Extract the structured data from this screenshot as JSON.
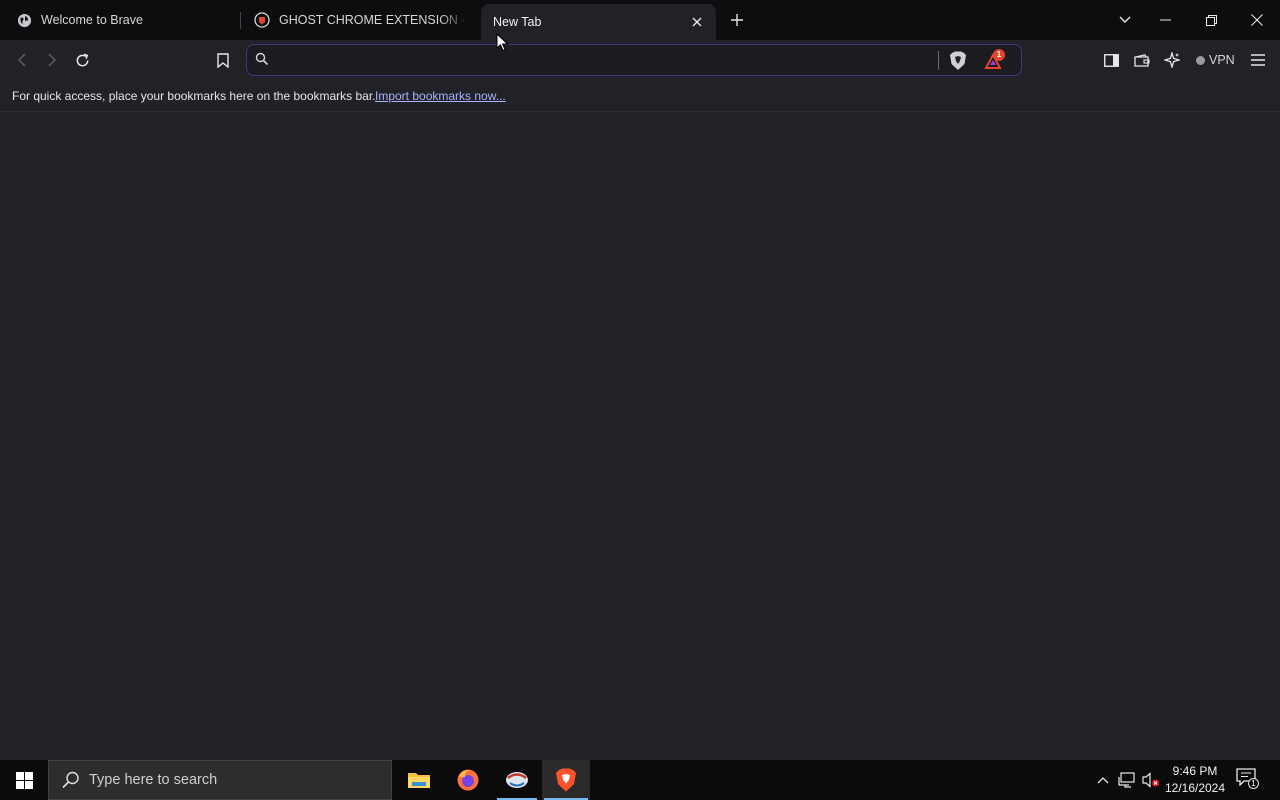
{
  "tabs": [
    {
      "label": "Welcome to Brave",
      "icon": "globe-icon"
    },
    {
      "label": "GHOST CHROME EXTENSION - Brave",
      "icon": "ghost-extension-icon"
    },
    {
      "label": "New Tab",
      "icon": "",
      "active": true
    }
  ],
  "toolbar": {
    "address_value": "",
    "rewards_badge": "1",
    "vpn_label": "VPN"
  },
  "bookmarks_bar": {
    "message": "For quick access, place your bookmarks here on the bookmarks bar.",
    "import_link": "Import bookmarks now..."
  },
  "taskbar": {
    "search_placeholder": "Type here to search",
    "apps": [
      "file-explorer-icon",
      "firefox-icon",
      "ghost-app-icon",
      "brave-icon"
    ],
    "time": "9:46 PM",
    "date": "12/16/2024",
    "notification_count": "1"
  },
  "colors": {
    "tabstrip_bg": "#0d0d0f",
    "page_bg": "#212127",
    "accent_link": "#a9b3ff",
    "omnibox_border": "#3a3a78",
    "taskbar_bg": "#0b0b0c"
  }
}
